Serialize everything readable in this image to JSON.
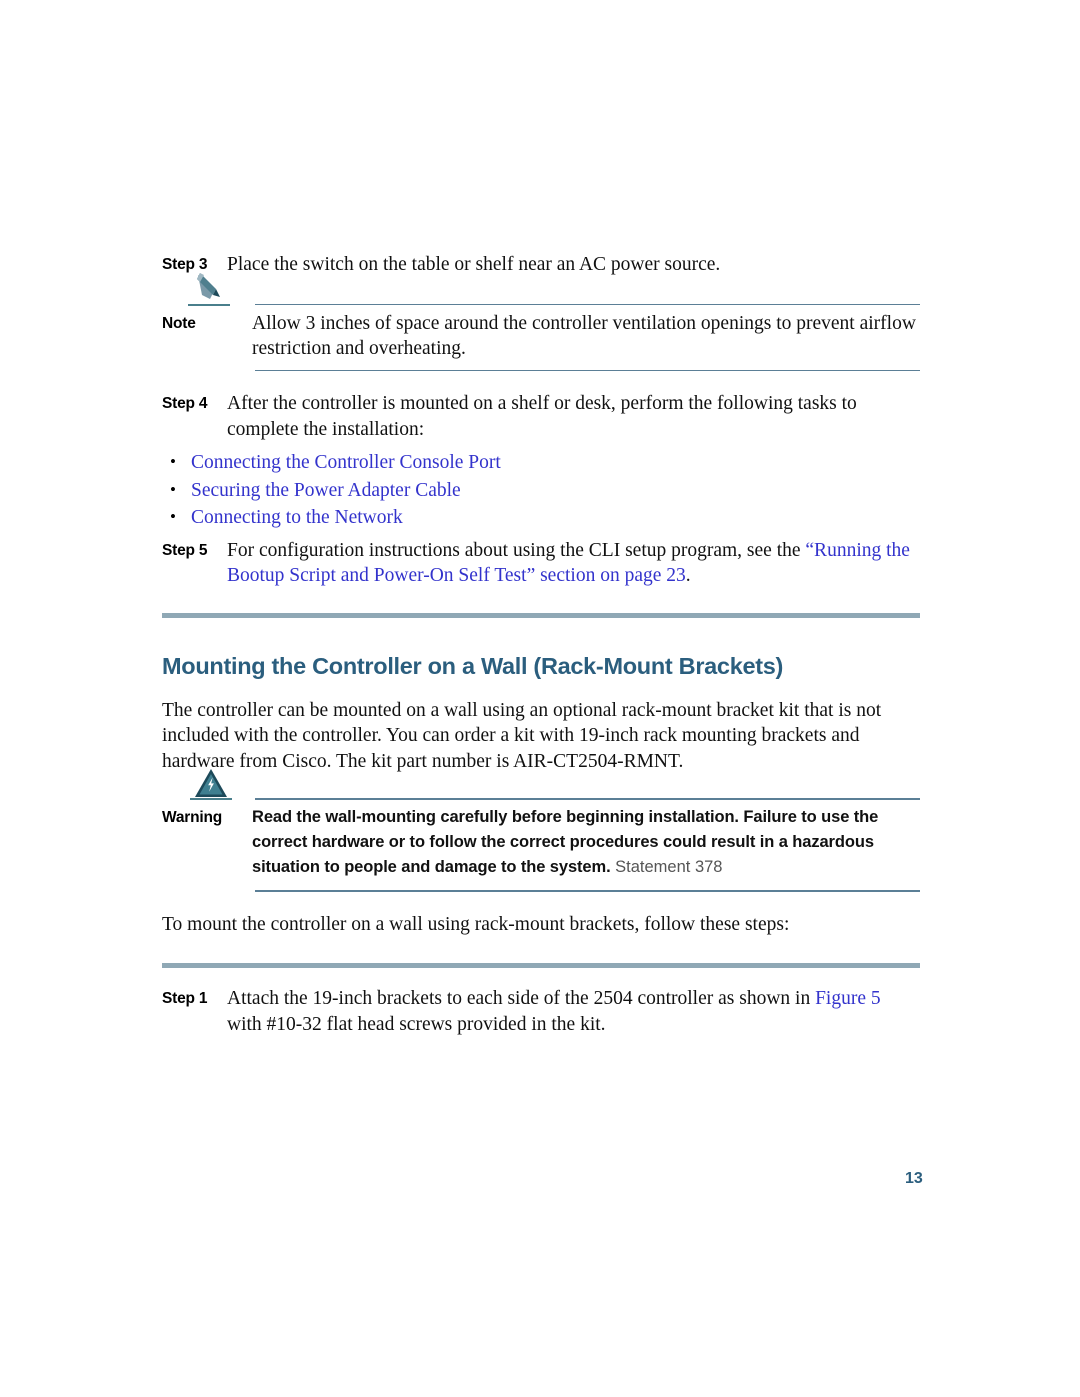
{
  "page": {
    "number": "13",
    "background": "#ffffff",
    "link_color": "#3333cc",
    "heading_color": "#2b5e7e",
    "rule_color": "#8fa8b5",
    "admon_rule_color": "#5b7f96"
  },
  "steps": {
    "step3": {
      "label": "Step 3",
      "text": "Place the switch on the table or shelf near an AC power source."
    },
    "step4": {
      "label": "Step 4",
      "text": "After the controller is mounted on a shelf or desk, perform the following tasks to complete the installation:",
      "bullets": [
        "Connecting the Controller Console Port",
        "Securing the Power Adapter Cable",
        "Connecting to the Network"
      ]
    },
    "step5": {
      "label": "Step 5",
      "text_before": "For configuration instructions about using the CLI setup program, see the ",
      "link": "“Running the Bootup Script and Power-On Self Test” section on page 23",
      "text_after": "."
    },
    "wall_step1": {
      "label": "Step 1",
      "text_before": "Attach the 19-inch brackets to each side of the 2504 controller as shown in ",
      "link": "Figure 5",
      "text_after": " with #10-32 flat head screws provided in the kit."
    }
  },
  "note": {
    "icon": "pencil-icon",
    "label": "Note",
    "text": "Allow 3 inches of space around the controller ventilation openings to prevent airflow restriction and overheating."
  },
  "warning": {
    "icon": "warning-triangle-icon",
    "label": "Warning",
    "text": "Read the wall-mounting carefully before beginning installation. Failure to use the correct hardware or to follow the correct procedures could result in a hazardous situation to people and damage to the system.",
    "statement": " Statement 378"
  },
  "section": {
    "heading": "Mounting the Controller on a Wall (Rack-Mount Brackets)",
    "intro": "The controller can be mounted on a wall using an optional rack-mount bracket kit that is not included with the controller. You can order a kit with 19-inch rack mounting brackets and hardware from Cisco. The kit part number is AIR-CT2504-RMNT.",
    "steps_intro": "To mount the controller on a wall using rack-mount brackets, follow these steps:"
  }
}
